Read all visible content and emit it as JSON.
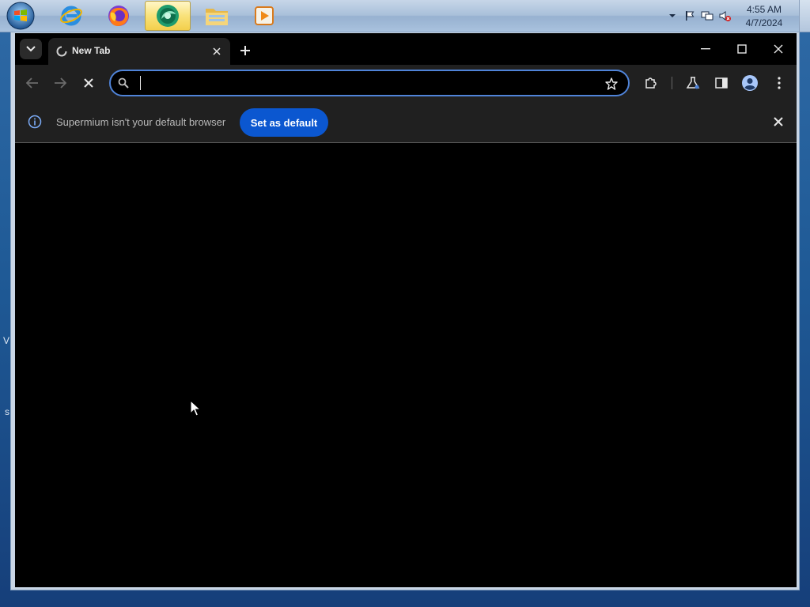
{
  "taskbar": {
    "start_icon": "windows-orb",
    "pinned": [
      {
        "icon": "internet-explorer-icon",
        "active": false
      },
      {
        "icon": "firefox-icon",
        "active": false
      },
      {
        "icon": "supermium-icon",
        "active": true
      },
      {
        "icon": "file-explorer-icon",
        "active": false
      },
      {
        "icon": "media-player-icon",
        "active": false
      }
    ],
    "tray": {
      "icons": [
        "chevron-up-icon",
        "action-center-flag-icon",
        "network-icon",
        "volume-muted-icon"
      ],
      "time": "4:55 AM",
      "date": "4/7/2024"
    }
  },
  "browser": {
    "tab": {
      "title": "New Tab",
      "favicon": "loading-favicon-icon"
    },
    "window_controls": [
      "minimize-icon",
      "maximize-icon",
      "close-icon"
    ],
    "toolbar": {
      "back": "back-arrow-icon",
      "forward": "forward-arrow-icon",
      "stop": "stop-loading-icon",
      "omnibox_value": "",
      "omnibox_placeholder": "",
      "right_icons": [
        "extensions-icon",
        "labs-flask-icon",
        "side-panel-icon",
        "profile-avatar-icon",
        "more-menu-icon"
      ]
    },
    "infobar": {
      "message": "Supermium isn't your default browser",
      "button": "Set as default"
    },
    "colors": {
      "accent": "#0b57d0",
      "omnibox_border": "#4f83d8"
    }
  }
}
